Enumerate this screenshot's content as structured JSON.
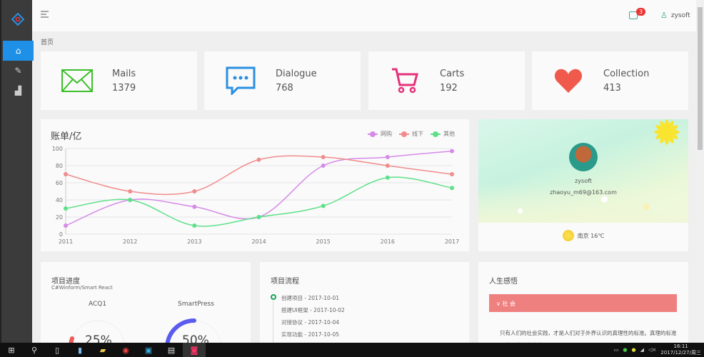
{
  "header": {
    "notification_count": "3",
    "username": "zysoft"
  },
  "breadcrumb": "首页",
  "stats": [
    {
      "label": "Mails",
      "value": "1379",
      "icon": "mail-icon",
      "color": "#3cbf2a"
    },
    {
      "label": "Dialogue",
      "value": "768",
      "icon": "chat-icon",
      "color": "#2a8fe0"
    },
    {
      "label": "Carts",
      "value": "192",
      "icon": "cart-icon",
      "color": "#e5317a"
    },
    {
      "label": "Collection",
      "value": "413",
      "icon": "heart-icon",
      "color": "#ef5a4d"
    }
  ],
  "chart_data": {
    "type": "line",
    "title": "账单/亿",
    "categories": [
      "2011",
      "2012",
      "2013",
      "2014",
      "2015",
      "2016",
      "2017"
    ],
    "series": [
      {
        "name": "网购",
        "color": "#d58be8",
        "values": [
          10,
          40,
          32,
          20,
          80,
          90,
          97
        ]
      },
      {
        "name": "线下",
        "color": "#f08c8c",
        "values": [
          70,
          50,
          50,
          87,
          90,
          80,
          70
        ]
      },
      {
        "name": "其他",
        "color": "#5ee08a",
        "values": [
          30,
          40,
          10,
          20,
          33,
          66,
          54
        ]
      }
    ],
    "yticks": [
      "0",
      "20",
      "40",
      "60",
      "80",
      "100"
    ],
    "ylim": [
      0,
      100
    ],
    "legend": "top-right",
    "grid": true
  },
  "profile": {
    "name": "zysoft",
    "email": "zhaoyu_m69@163.com",
    "weather": "南京 16℃"
  },
  "progress": {
    "title": "项目进度",
    "subtitle": "C#Winform/Smart React",
    "gauges": [
      {
        "name": "ACQ1",
        "percent": 25,
        "label": "25%",
        "color": "#ef5a5a"
      },
      {
        "name": "SmartPress",
        "percent": 50,
        "label": "50%",
        "color": "#5b5bf0"
      }
    ]
  },
  "flow": {
    "title": "项目流程",
    "items": [
      "创建项目 - 2017-10-01",
      "搭建UI框架 - 2017-10-02",
      "对接协议 - 2017-10-04",
      "实现功能 - 2017-10-05"
    ]
  },
  "life": {
    "title": "人生感悟",
    "tab": "∨ 社 会",
    "text": "只有人们的社会实践，才是人们对于外界认识的真理性的标准。真理的标准只能是社会的实践"
  },
  "taskbar": {
    "time": "16:11",
    "date": "2017/12/27/周三"
  }
}
